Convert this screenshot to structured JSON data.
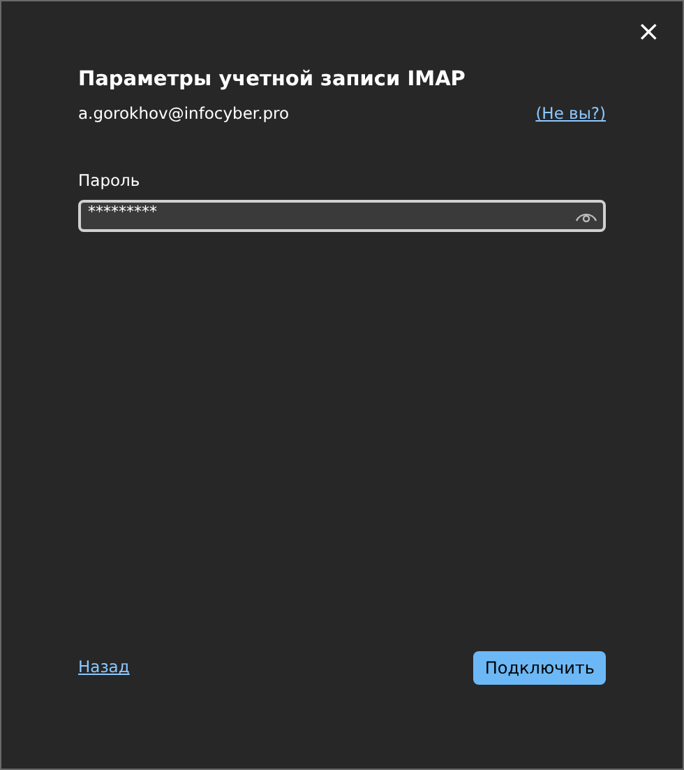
{
  "dialog": {
    "close": "×",
    "title": "Параметры учетной записи IMAP",
    "account": "a.gorokhov@infocyber.pro",
    "not_you_link": "(Не вы?)"
  },
  "password": {
    "label": "Пароль",
    "value": "*********",
    "focused": true
  },
  "footer": {
    "back_link": "Назад",
    "connect_button": "Подключить"
  }
}
